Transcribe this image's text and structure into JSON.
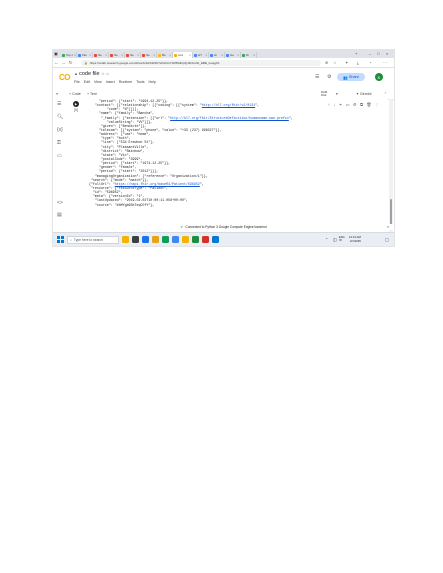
{
  "tabs": [
    {
      "label": "Top c",
      "color": "#34a853"
    },
    {
      "label": "File",
      "color": "#4285f4"
    },
    {
      "label": "Ne",
      "color": "#ea4335"
    },
    {
      "label": "Ne",
      "color": "#ea4335"
    },
    {
      "label": "Ne",
      "color": "#ea4335"
    },
    {
      "label": "Ne",
      "color": "#ea4335"
    },
    {
      "label": "Be",
      "color": "#fbbc04"
    },
    {
      "label": "cod",
      "color": "#f9ab00"
    },
    {
      "label": "HT",
      "color": "#4285f4"
    },
    {
      "label": "Hi",
      "color": "#4285f4"
    },
    {
      "label": "Ge",
      "color": "#4285f4"
    },
    {
      "label": "Di",
      "color": "#34a853"
    }
  ],
  "address": {
    "url": "https://colab.research.google.com/drive/1l4chbW20YvKtHVsYbP86dFqtQJ4hfoxhb_EBE_luoqgK1"
  },
  "colab": {
    "logo": "CO",
    "file_name": "code file",
    "menus": [
      "File",
      "Edit",
      "View",
      "Insert",
      "Runtime",
      "Tools",
      "Help"
    ],
    "share_label": "Share",
    "avatar_letter": "K"
  },
  "toolbar": {
    "add_code": "+ Code",
    "add_text": "+ Text",
    "ram": "RAM",
    "disk": "Disk",
    "gemini": "Gemini"
  },
  "cell": {
    "number": "[5]"
  },
  "code_lines": [
    "      \"period\": {\"start\": \"1994-12-25\"}},",
    "    \"contact\": [{\"relationship\": [{\"coding\": [{\"system\": \"http://hl7.org/fhir/v2/0131\",",
    "          \"code\": \"N\"}]}],",
    "      \"name\": {\"family\": \"Bancha\",",
    "       \"_family\": {\"extension\": [{\"url\": \"http://hl7.org/fhir/StructureDefinition/humanname-own-prefix\",",
    "          \"valueString\": \"VV\"}]},",
    "       \"given\": [\"Bendicte\"]},",
    "      \"telecom\": [{\"system\": \"phone\", \"value\": \"+33 (237) 998327\"}],",
    "      \"address\": {\"use\": \"home\",",
    "       \"type\": \"both\",",
    "       \"line\": [\"534 Erewhon St\"],",
    "       \"city\": \"PleasantVille\",",
    "       \"district\": \"Rainbow\",",
    "       \"state\": \"Vic\",",
    "       \"postalCode\": \"3999\",",
    "       \"period\": {\"start\": \"1974-12-25\"}},",
    "      \"gender\": \"female\",",
    "      \"period\": {\"start\": \"2012\"}}],",
    "    \"managingOrganization\": {\"reference\": \"Organization/1\"}},",
    "  \"search\": {\"mode\": \"match\"}},",
    " {\"fullUrl\": \"https://hapi.fhir.org/baseR4/Patient/596952\",",
    "  \"resource\": {\"resourceType\": \"Patient\",",
    "   \"id\": \"596952\",",
    "   \"meta\": {\"versionId\": \"1\",",
    "    \"lastUpdated\": \"2019-02-02T10:00:11.058+00:00\",",
    "    \"source\": \"#bMYgb9SbTeqCOfY\"},"
  ],
  "status": {
    "text": "Connected to Python 3 Google Compute Engine backend"
  },
  "taskbar": {
    "search_placeholder": "Type here to search",
    "language": "ENG",
    "region": "IN",
    "time": "12:41 AM",
    "date": "2/1/2025",
    "app_colors": [
      "#f4b400",
      "#3c4043",
      "#1a73e8",
      "#e8a317",
      "#0f9d58",
      "#4285f4",
      "#f4b400",
      "#1e8e3e",
      "#d93025",
      "#0078d4"
    ]
  }
}
